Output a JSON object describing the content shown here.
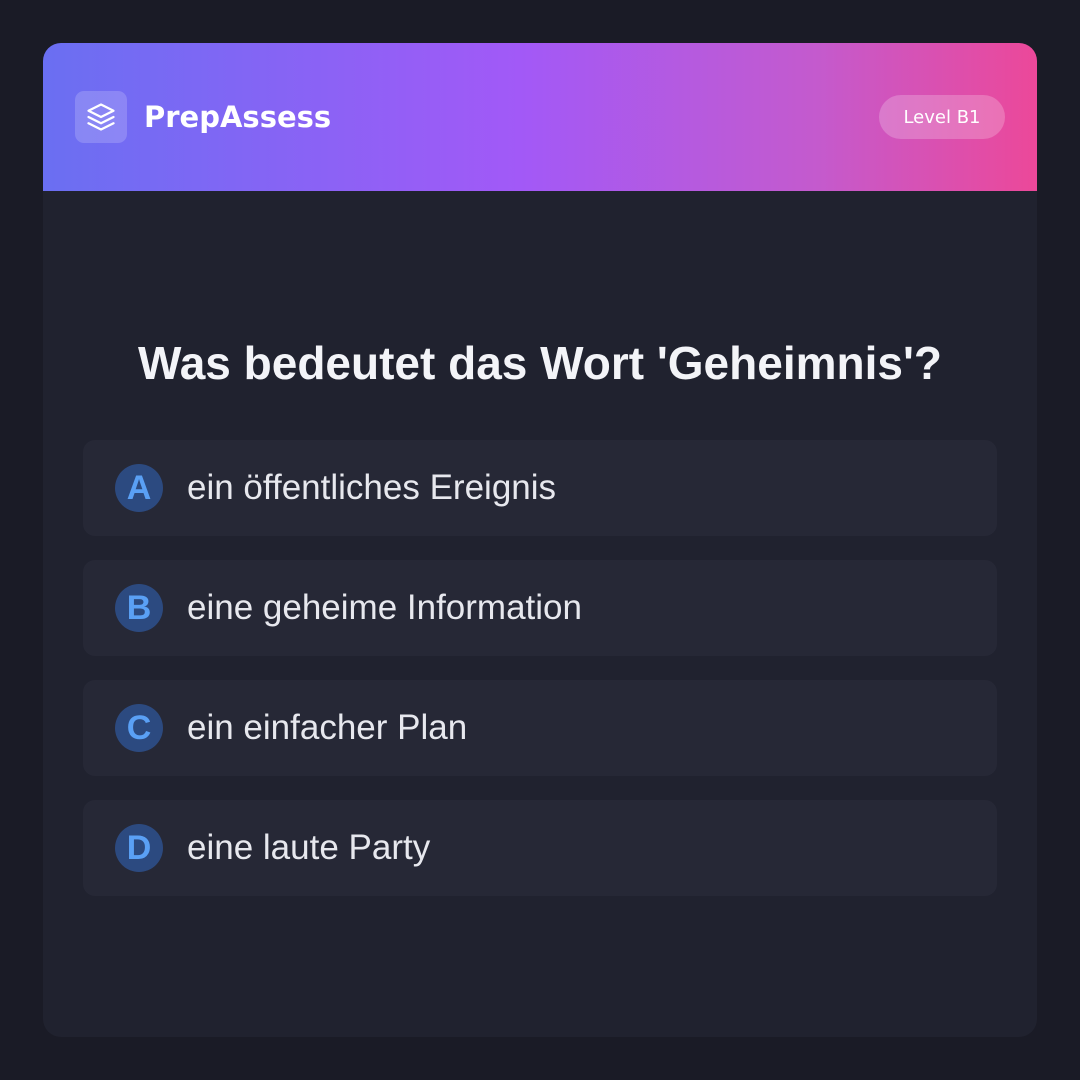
{
  "header": {
    "brand": "PrepAssess",
    "logo_icon": "layers-icon",
    "level": "Level B1"
  },
  "quiz": {
    "question": "Was bedeutet das Wort 'Geheimnis'?",
    "options": [
      {
        "letter": "A",
        "text": "ein öffentliches Ereignis"
      },
      {
        "letter": "B",
        "text": "eine geheime Information"
      },
      {
        "letter": "C",
        "text": "ein einfacher Plan"
      },
      {
        "letter": "D",
        "text": "eine laute Party"
      }
    ]
  },
  "colors": {
    "background": "#1a1b26",
    "card": "#20222f",
    "option_bg": "#262836",
    "letter_bg": "#2c4a80",
    "letter_fg": "#5aa0f5",
    "gradient_start": "#6a6ff2",
    "gradient_mid": "#a259f7",
    "gradient_end": "#ec4899"
  }
}
